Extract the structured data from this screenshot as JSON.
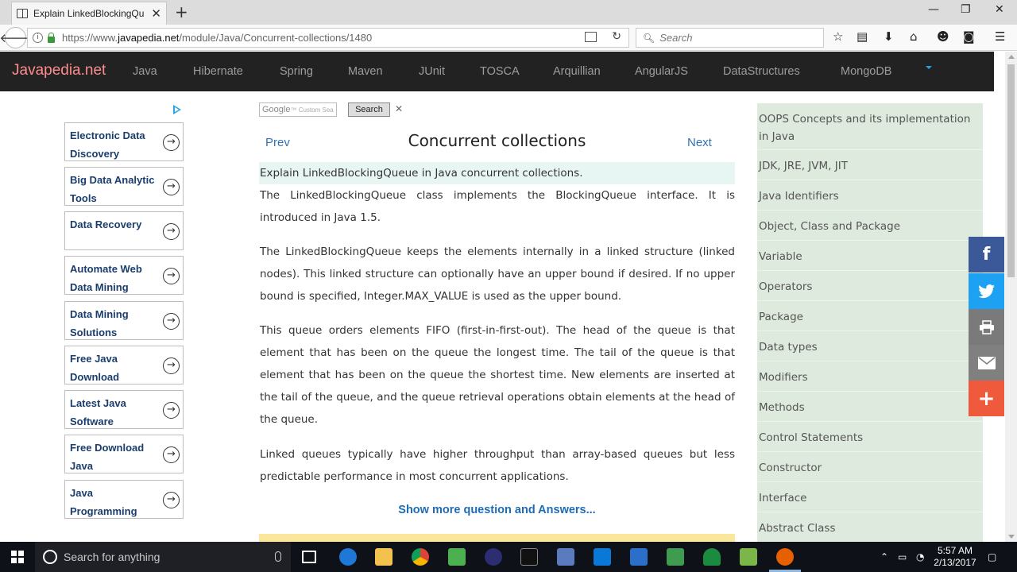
{
  "browser": {
    "tab_title": "Explain LinkedBlockingQu...",
    "url_prefix": "https://www.",
    "url_domain": "javapedia.net",
    "url_path": "/module/Java/Concurrent-collections/1480",
    "search_placeholder": "Search"
  },
  "site": {
    "brand": "Javapedia.net",
    "nav": [
      "Java",
      "Hibernate",
      "Spring",
      "Maven",
      "JUnit",
      "TOSCA",
      "Arquillian",
      "AngularJS",
      "DataStructures",
      "MongoDB"
    ]
  },
  "ads": [
    {
      "label": "Electronic Data Discovery"
    },
    {
      "label": "Big Data Analytic Tools"
    },
    {
      "label": "Data Recovery"
    },
    {
      "label": "Automate Web Data Mining"
    },
    {
      "label": "Data Mining Solutions"
    },
    {
      "label": "Free Java Download"
    },
    {
      "label": "Latest Java Software"
    },
    {
      "label": "Free Download Java"
    },
    {
      "label": "Java Programming"
    }
  ],
  "google_search": {
    "brand": "Google",
    "placeholder": "Custom Sea",
    "button": "Search",
    "clear": "✕"
  },
  "article": {
    "prev": "Prev",
    "next": "Next",
    "title": "Concurrent collections",
    "question": "Explain LinkedBlockingQueue in Java concurrent collections.",
    "paragraphs": [
      "The LinkedBlockingQueue class implements the BlockingQueue interface. It is introduced in Java 1.5.",
      "The LinkedBlockingQueue keeps the elements internally in a linked structure (linked nodes). This linked structure can optionally have an upper bound if desired. If no upper bound is specified, Integer.MAX_VALUE is used as the upper bound.",
      "This queue orders elements FIFO (first-in-first-out). The head of the queue is that element that has been on the queue the longest time. The tail of the queue is that element that has been on the queue the shortest time. New elements are inserted at the tail of the queue, and the queue retrieval operations obtain elements at the head of the queue.",
      "Linked queues typically have higher throughput than array-based queues but less predictable performance in most concurrent applications."
    ],
    "more_link": "Show more question and Answers..."
  },
  "topics": [
    "OOPS Concepts and its implementation in Java",
    "JDK, JRE, JVM, JIT",
    "Java Identifiers",
    "Object, Class and Package",
    "Variable",
    "Operators",
    "Package",
    "Data types",
    "Modifiers",
    "Methods",
    "Control Statements",
    "Constructor",
    "Interface",
    "Abstract Class"
  ],
  "share": {
    "facebook": "f",
    "plus": "+"
  },
  "taskbar": {
    "search_placeholder": "Search for anything",
    "time": "5:57 AM",
    "date": "2/13/2017"
  },
  "colors": {
    "site_nav_bg": "#222222",
    "brand": "#ff8c8c",
    "link": "#3273b8",
    "topic_bg": "#deeade",
    "question_bg": "#e8f6f3",
    "facebook": "#3b5998",
    "twitter": "#1da1f2",
    "plus": "#f05a3c"
  }
}
